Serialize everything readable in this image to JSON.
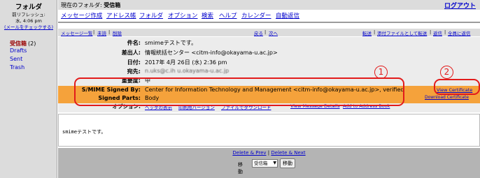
{
  "sidebar": {
    "title": "フォルダ",
    "last_refresh": "前リフレッシュ:",
    "last_time": "水, 4:06 pm",
    "check_mail": "(メールをチェックする)",
    "folders": [
      {
        "label": "受信箱",
        "count": "(2)",
        "active": true
      },
      {
        "label": "Drafts"
      },
      {
        "label": "Sent"
      },
      {
        "label": "Trash"
      }
    ]
  },
  "topbar": {
    "current_folder_label": "現在のフォルダ:",
    "current_folder": "受信箱",
    "logout": "ログアウト"
  },
  "menu": [
    "メッセージ作成",
    "アドレス帳",
    "フォルダ",
    "オプション",
    "検索",
    "ヘルプ",
    "カレンダー",
    "自動返信"
  ],
  "navbar": {
    "message_list": "メッセージ一覧",
    "unread": "未読",
    "delete": "削除",
    "prev": "戻る",
    "next": "次へ",
    "sep": "|",
    "forward": "転送",
    "forward_attach": "添付ファイルとして転送",
    "reply": "返信",
    "reply_all": "全員に返信"
  },
  "header": {
    "subject_label": "件名:",
    "subject": "smimeテストです。",
    "from_label": "差出人:",
    "from": "情報統括センター <citm-info@okayama-u.ac.jp>",
    "date_label": "日付:",
    "date": "2017年 4月 26日 (水) 2:36 pm",
    "to_label": "宛先:",
    "to": "n.uks@c.ih u.okayama-u.ac.jp",
    "priority_label": "重要度:",
    "priority": "中"
  },
  "smime": {
    "signed_by_label": "S/MIME Signed By:",
    "signed_by": "Center for Information Technology and Management <citm-info@okayama-u.ac.jp>, verified",
    "signed_parts_label": "Signed Parts:",
    "signed_parts": "Body",
    "view_certificate": "View Certificate",
    "download_certificate": "Download Certificate"
  },
  "options": {
    "label": "オプション:",
    "links": [
      "ヘッダの表示",
      "印刷用バージョン",
      "ファイルでダウンロード",
      "View Message Details",
      "Add to Address Book"
    ]
  },
  "body": {
    "text": "smimeテストです。"
  },
  "bottom": {
    "delete_prev": "Delete & Prev",
    "delete_next": "Delete & Next",
    "sep": "|",
    "move_label": "移動",
    "move_select": "受信箱",
    "move_button": "移動"
  },
  "annotations": {
    "one": "1",
    "two": "2"
  },
  "colors": {
    "smime_band": "#f5a23b",
    "annotation": "#e21b1b",
    "link": "#0000cc"
  }
}
